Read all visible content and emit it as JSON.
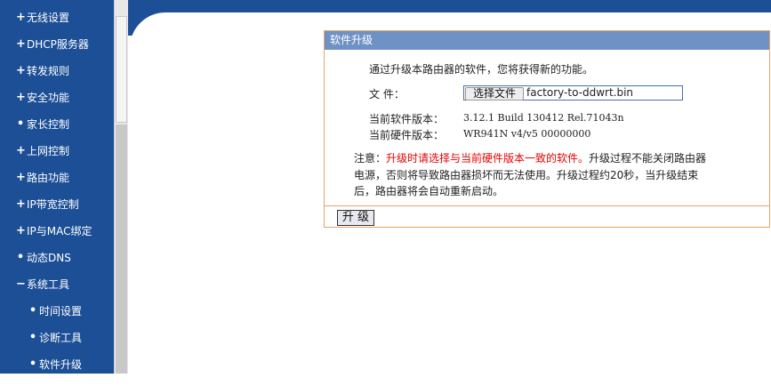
{
  "sidebar": {
    "items": [
      {
        "mark": "+",
        "label": "无线设置"
      },
      {
        "mark": "+",
        "label": "DHCP服务器"
      },
      {
        "mark": "+",
        "label": "转发规则"
      },
      {
        "mark": "+",
        "label": "安全功能"
      },
      {
        "mark": "•",
        "label": "家长控制"
      },
      {
        "mark": "+",
        "label": "上网控制"
      },
      {
        "mark": "+",
        "label": "路由功能"
      },
      {
        "mark": "+",
        "label": "IP带宽控制"
      },
      {
        "mark": "+",
        "label": "IP与MAC绑定"
      },
      {
        "mark": "•",
        "label": "动态DNS"
      },
      {
        "mark": "−",
        "label": "系统工具"
      },
      {
        "mark": "•",
        "label": "时间设置"
      },
      {
        "mark": "•",
        "label": "诊断工具"
      },
      {
        "mark": "•",
        "label": "软件升级"
      }
    ]
  },
  "panel": {
    "title": "软件升级",
    "intro": "通过升级本路由器的软件，您将获得新的功能。",
    "file_label": "文  件：",
    "choose_button": "选择文件",
    "file_name": "factory-to-ddwrt.bin",
    "sw_label": "当前软件版本：",
    "sw_value": "3.12.1 Build 130412 Rel.71043n",
    "hw_label": "当前硬件版本：",
    "hw_value": "WR941N v4/v5 00000000",
    "note_prefix": "注意：",
    "note_red": "升级时请选择与当前硬件版本一致的软件。",
    "note_rest1": "升级过程不能关闭路由器",
    "note_line2": "电源，否则将导致路由器损坏而无法使用。升级过程约20秒，当升级结束",
    "note_line3": "后，路由器将会自动重新启动。",
    "upgrade_button": "升 级"
  },
  "colors": {
    "sidebar_bg": "#1c4f96",
    "panel_title_bg": "#6f92c6",
    "panel_border": "#e8a36a",
    "warning_red": "#e60000"
  }
}
